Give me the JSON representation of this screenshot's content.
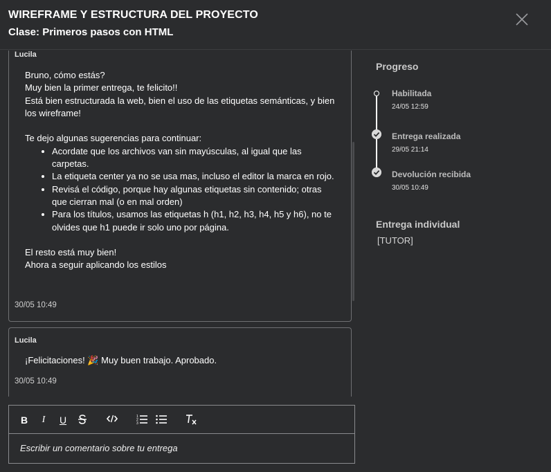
{
  "header": {
    "title": "WIREFRAME Y ESTRUCTURA DEL PROYECTO",
    "subtitle": "Clase: Primeros pasos con HTML",
    "close_icon": "close-icon"
  },
  "comments": [
    {
      "author": "Lucila",
      "paragraph1": [
        "Bruno, cómo estás?",
        "Muy bien la primer entrega, te felicito!!",
        "Está bien estructurada la web, bien el uso de las etiquetas semánticas, y bien los wireframe!"
      ],
      "intro": "Te dejo algunas sugerencias para continuar:",
      "suggestions": [
        "Acordate que los archivos van sin mayúsculas, al igual que las carpetas.",
        "La etiqueta center  ya no se usa mas, incluso el editor la marca en rojo.",
        "Revisá el código, porque hay algunas etiquetas sin contenido; otras que cierran mal (o en mal orden)",
        "Para los títulos, usamos las etiquetas h (h1, h2, h3, h4, h5 y h6), no te olvides que h1 puede ir solo uno por página."
      ],
      "closing": [
        "El resto está muy bien!",
        "Ahora a seguir aplicando los estilos"
      ],
      "date": "30/05 10:49"
    },
    {
      "author": "Lucila",
      "text_before": "¡Felicitaciones!",
      "emoji": "🎉",
      "text_after": "Muy buen trabajo. Aprobado.",
      "date": "30/05 10:49"
    }
  ],
  "editor": {
    "toolbar": [
      "bold",
      "italic",
      "underline",
      "strikethrough",
      "code",
      "ordered-list",
      "bullet-list",
      "clear-format"
    ],
    "placeholder": "Escribir un comentario sobre tu entrega"
  },
  "progress": {
    "title": "Progreso",
    "steps": [
      {
        "label": "Habilitada",
        "date": "24/05 12:59",
        "status": "open"
      },
      {
        "label": "Entrega realizada",
        "date": "29/05 21:14",
        "status": "done"
      },
      {
        "label": "Devolución recibida",
        "date": "30/05 10:49",
        "status": "done"
      }
    ]
  },
  "delivery": {
    "title": "Entrega individual",
    "tutor": "[TUTOR]"
  }
}
